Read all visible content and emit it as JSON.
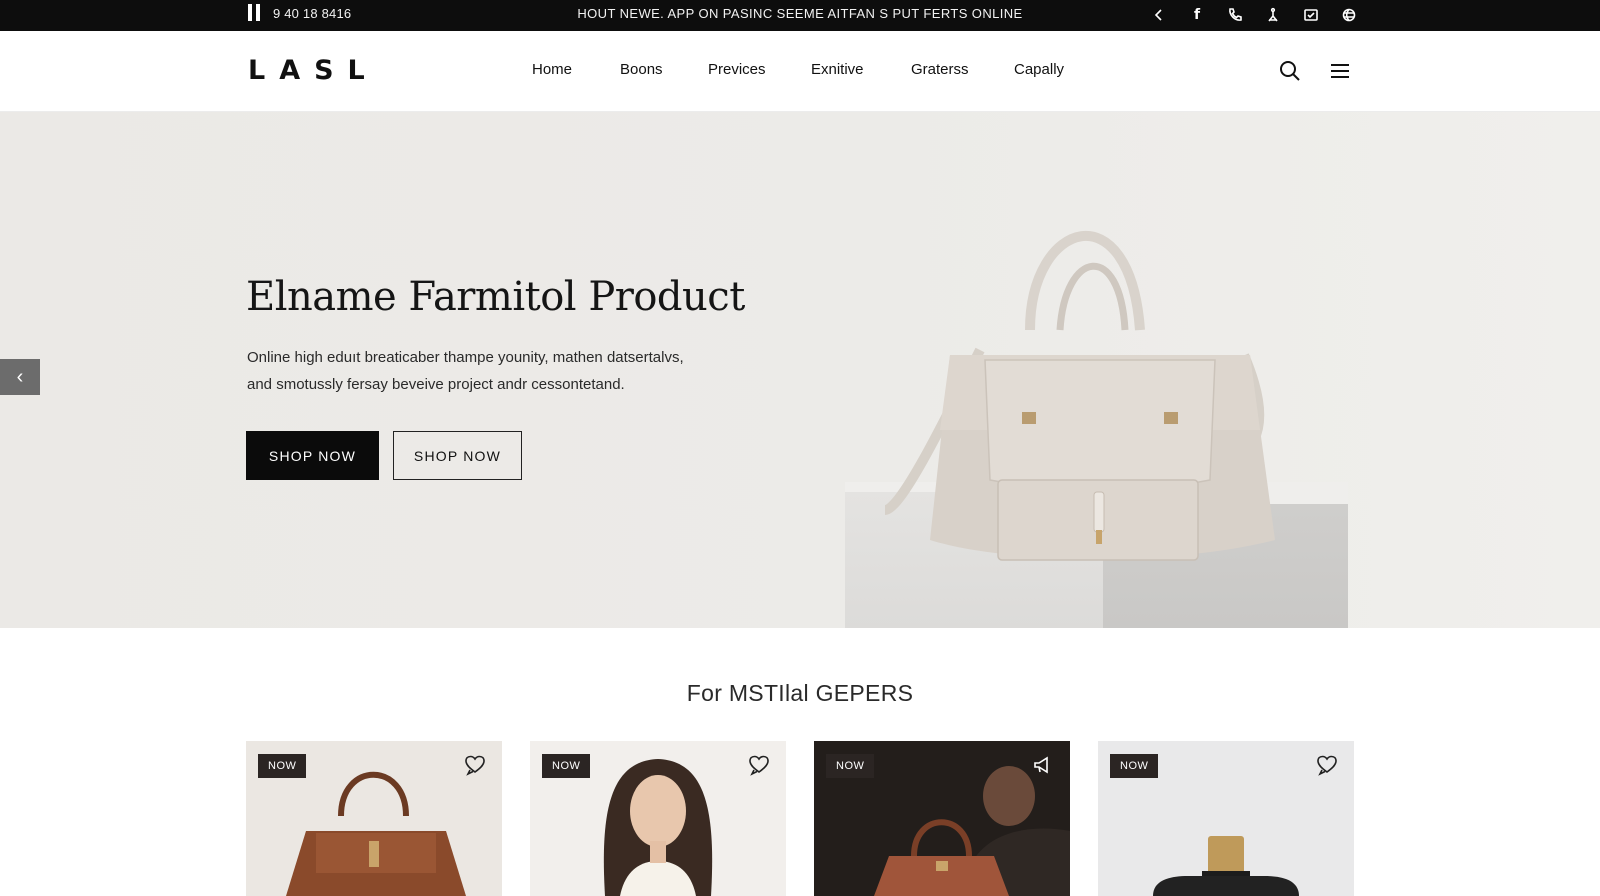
{
  "topbar": {
    "phone": "9 40 18 8416",
    "promo": "HOUT NEWE. APP ON PASINC SEEME AITFAN S PUT FERTS ONLINE",
    "social_icons": [
      "chevron-left-icon",
      "facebook-icon",
      "phone-icon",
      "accessibility-icon",
      "mail-icon",
      "globe-icon"
    ]
  },
  "header": {
    "logo": "LASL",
    "nav": [
      "Home",
      "Boons",
      "Previces",
      "Exnitive",
      "Graterss",
      "Capally"
    ],
    "icons": [
      "search-icon",
      "menu-icon"
    ]
  },
  "hero": {
    "title": "Elname Farmitol Product",
    "desc_line1": "Online high eduıt breaticaber thampe younity, mathen datsertalvs,",
    "desc_line2": "and smotussly fersay beveive project andr cessontetand.",
    "btn_primary": "SHOP NOW",
    "btn_secondary": "SHOP NOW",
    "prev_arrow": "‹"
  },
  "section": {
    "title": "For MSTIlal GEPERS"
  },
  "products": [
    {
      "badge": "NOW",
      "fav_icon": "heart-chat-icon",
      "image": "brown-handbag"
    },
    {
      "badge": "NOW",
      "fav_icon": "heart-chat-icon",
      "image": "woman-portrait"
    },
    {
      "badge": "NOW",
      "fav_icon": "megaphone-icon",
      "image": "man-with-handbag"
    },
    {
      "badge": "NOW",
      "fav_icon": "heart-chat-icon",
      "image": "perfume-bottle"
    }
  ],
  "colors": {
    "topbar_bg": "#0d0d0d",
    "hero_bg": "#ebe9e6",
    "button_dark": "#0b0b0b",
    "badge_bg": "#2b2523"
  }
}
